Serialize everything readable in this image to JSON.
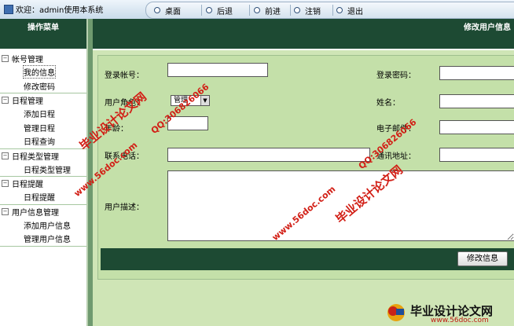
{
  "topbar": {
    "welcome": "欢迎：admin使用本系统",
    "nav": [
      {
        "label": "桌面"
      },
      {
        "label": "后退"
      },
      {
        "label": "前进"
      },
      {
        "label": "注销"
      },
      {
        "label": "退出"
      }
    ]
  },
  "sidebar": {
    "title": "操作菜单",
    "groups": [
      {
        "label": "帐号管理",
        "items": [
          "我的信息",
          "修改密码"
        ]
      },
      {
        "label": "日程管理",
        "items": [
          "添加日程",
          "管理日程",
          "日程查询"
        ]
      },
      {
        "label": "日程类型管理",
        "items": [
          "日程类型管理"
        ]
      },
      {
        "label": "日程提醒",
        "items": [
          "日程提醒"
        ]
      },
      {
        "label": "用户信息管理",
        "items": [
          "添加用户信息",
          "管理用户信息"
        ]
      }
    ]
  },
  "main": {
    "title": "修改用户信息",
    "form": {
      "login_account": {
        "label": "登录帐号：",
        "value": ""
      },
      "login_password": {
        "label": "登录密码：",
        "value": ""
      },
      "user_role": {
        "label": "用户角色：",
        "value": "管理"
      },
      "name": {
        "label": "姓名：",
        "value": ""
      },
      "age": {
        "label": "年龄：",
        "value": ""
      },
      "email": {
        "label": "电子邮件：",
        "value": ""
      },
      "phone": {
        "label": "联系电话：",
        "value": ""
      },
      "address": {
        "label": "通讯地址：",
        "value": ""
      },
      "description": {
        "label": "用户描述：",
        "value": ""
      }
    },
    "submit_label": "修改信息"
  },
  "watermarks": {
    "site": "毕业设计论文网",
    "url": "www.56doc.com",
    "qq": "QQ:306826066"
  },
  "logo": {
    "title": "毕业设计论文网",
    "url": "www.56doc.com"
  }
}
